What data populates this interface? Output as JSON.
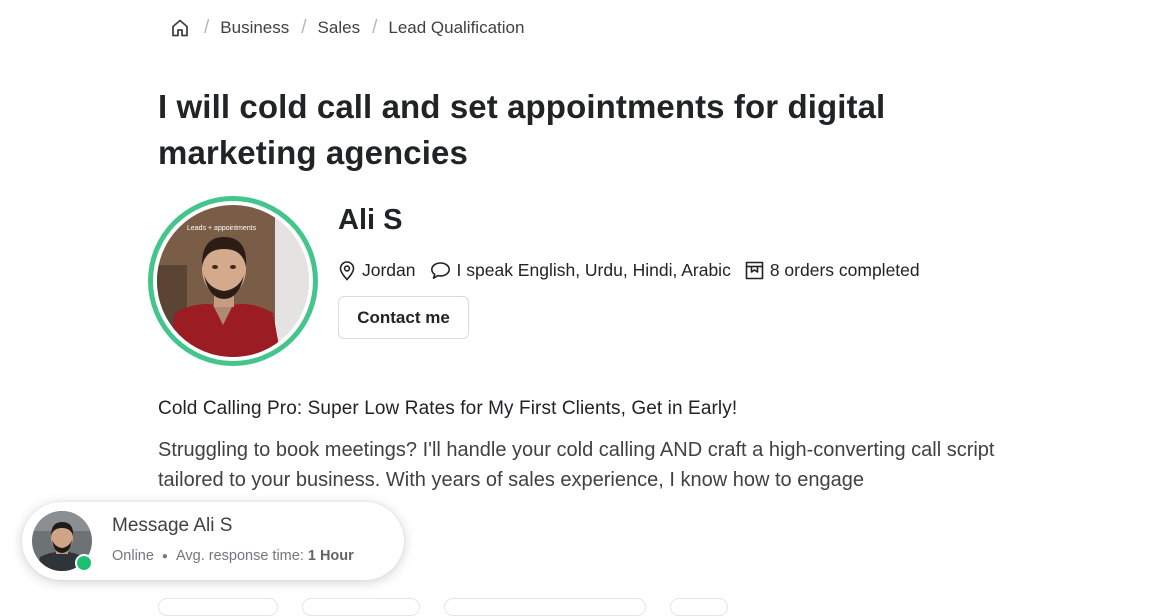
{
  "breadcrumb": {
    "home_icon": "home-icon",
    "items": [
      "Business",
      "Sales",
      "Lead Qualification"
    ]
  },
  "gig": {
    "title": "I will cold call and set appointments for digital marketing agencies"
  },
  "seller": {
    "name": "Ali S",
    "video_overlay_text": "Leads + appointments",
    "location": "Jordan",
    "languages": "I speak English, Urdu, Hindi, Arabic",
    "orders": "8 orders completed",
    "contact_label": "Contact me",
    "icons": {
      "location": "map-pin-icon",
      "languages": "speech-bubble-icon",
      "orders": "orders-box-icon"
    }
  },
  "description": {
    "heading": "Cold Calling Pro: Super Low Rates for My First Clients, Get in Early!",
    "body": "Struggling to book meetings? I'll handle your cold calling AND craft a high-converting call script tailored to your business. With years of sales experience, I know how to engage"
  },
  "message_popup": {
    "title": "Message Ali S",
    "status": "Online",
    "response_label": "Avg. response time:",
    "response_value": "1 Hour"
  },
  "colors": {
    "accent_green": "#1dbf73",
    "ring_green": "#43c58c",
    "text_dark": "#222325",
    "text_muted": "#74767e"
  }
}
